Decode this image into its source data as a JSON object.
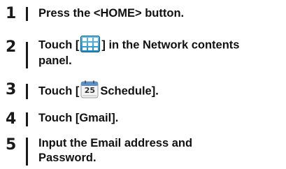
{
  "steps": [
    {
      "number": "1",
      "text": "Press the <HOME> button."
    },
    {
      "number": "2",
      "text_before": "Touch [",
      "icon": "grid-menu-icon",
      "text_after": "] in the Network contents",
      "line2": "panel."
    },
    {
      "number": "3",
      "text_before": "Touch [",
      "icon": "calendar-schedule-icon",
      "icon_text": "25",
      "text_after": "Schedule]."
    },
    {
      "number": "4",
      "text": "Touch [Gmail]."
    },
    {
      "number": "5",
      "line1": "Input the Email address and",
      "line2": "Password."
    }
  ]
}
